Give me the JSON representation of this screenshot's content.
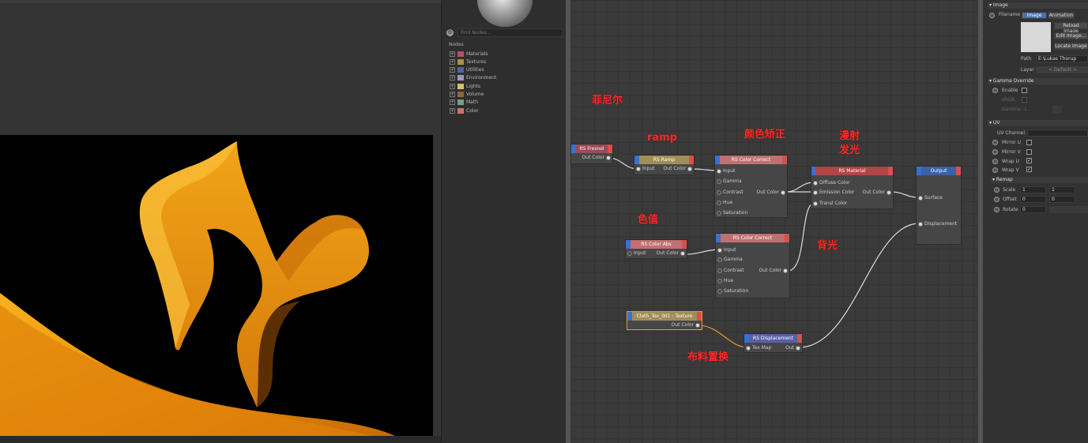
{
  "browser": {
    "search_placeholder": "Find Nodes...",
    "heading": "Nodes",
    "categories": [
      {
        "label": "Materials",
        "color": "#b0506a"
      },
      {
        "label": "Textures",
        "color": "#a8924a"
      },
      {
        "label": "Utilities",
        "color": "#5a5ea8"
      },
      {
        "label": "Environment",
        "color": "#9a9ab8"
      },
      {
        "label": "Lights",
        "color": "#d8c06a"
      },
      {
        "label": "Volume",
        "color": "#8a6a3a"
      },
      {
        "label": "Math",
        "color": "#7aa07a"
      },
      {
        "label": "Color",
        "color": "#d07070"
      }
    ]
  },
  "graph": {
    "nodes": {
      "fresnel": {
        "title": "RS Fresnel",
        "out": "Out Color"
      },
      "ramp": {
        "title": "RS Ramp",
        "in": "Input",
        "out": "Out Color"
      },
      "cc1": {
        "title": "RS Color Correct",
        "in": [
          "Input",
          "Gamma",
          "Contrast",
          "Hue",
          "Saturation"
        ],
        "out": "Out Color"
      },
      "material": {
        "title": "RS Material",
        "in": [
          "Diffuse Color",
          "Emission Color",
          "Transl Color"
        ],
        "out": "Out Color"
      },
      "output": {
        "title": "Output",
        "in": [
          "Surface",
          "Displacement"
        ]
      },
      "abs": {
        "title": "RS Color Abs",
        "in": "Input",
        "out": "Out Color"
      },
      "cc2": {
        "title": "RS Color Correct",
        "in": [
          "Input",
          "Gamma",
          "Contrast",
          "Hue",
          "Saturation"
        ],
        "out": "Out Color"
      },
      "tex": {
        "title": "Cloth_Tex_001 : Texture",
        "out": "Out Color"
      },
      "disp": {
        "title": "RS Displacement",
        "in": "Tex Map",
        "out": "Out"
      }
    },
    "annotations": {
      "fresnel": "菲尼尔",
      "ramp": "ramp",
      "cc": "颜色矫正",
      "diffuse": "漫射",
      "emission": "发光",
      "abs": "色值",
      "back": "背光",
      "cloth": "布料置换"
    }
  },
  "attr": {
    "image_section": "Image",
    "filename_label": "Filename",
    "tab_image": "Image",
    "tab_animation": "Animation",
    "reload": "Reload Image",
    "edit": "Edit Image...",
    "locate": "Locate Image",
    "path_label": "Path",
    "path_value": "E:\\Lukas Thorup Produ",
    "layer_label": "Layer",
    "layer_value": "< Default >",
    "gamma_section": "Gamma Override",
    "enable_label": "Enable",
    "srgb_label": "sRGB",
    "gamma_label": "Gamma",
    "gamma_value": "1",
    "uv_section": "UV",
    "uv_channel_label": "UV Channel",
    "mirror_u": "Mirror U",
    "mirror_v": "Mirror V",
    "wrap_u": "Wrap U",
    "wrap_v": "Wrap V",
    "remap_section": "Remap",
    "scale_label": "Scale",
    "scale_x": "1",
    "scale_y": "1",
    "offset_label": "Offset",
    "offset_x": "0",
    "offset_y": "0",
    "rotate_label": "Rotate",
    "rotate_value": "0",
    "checked_mark": "✓"
  }
}
